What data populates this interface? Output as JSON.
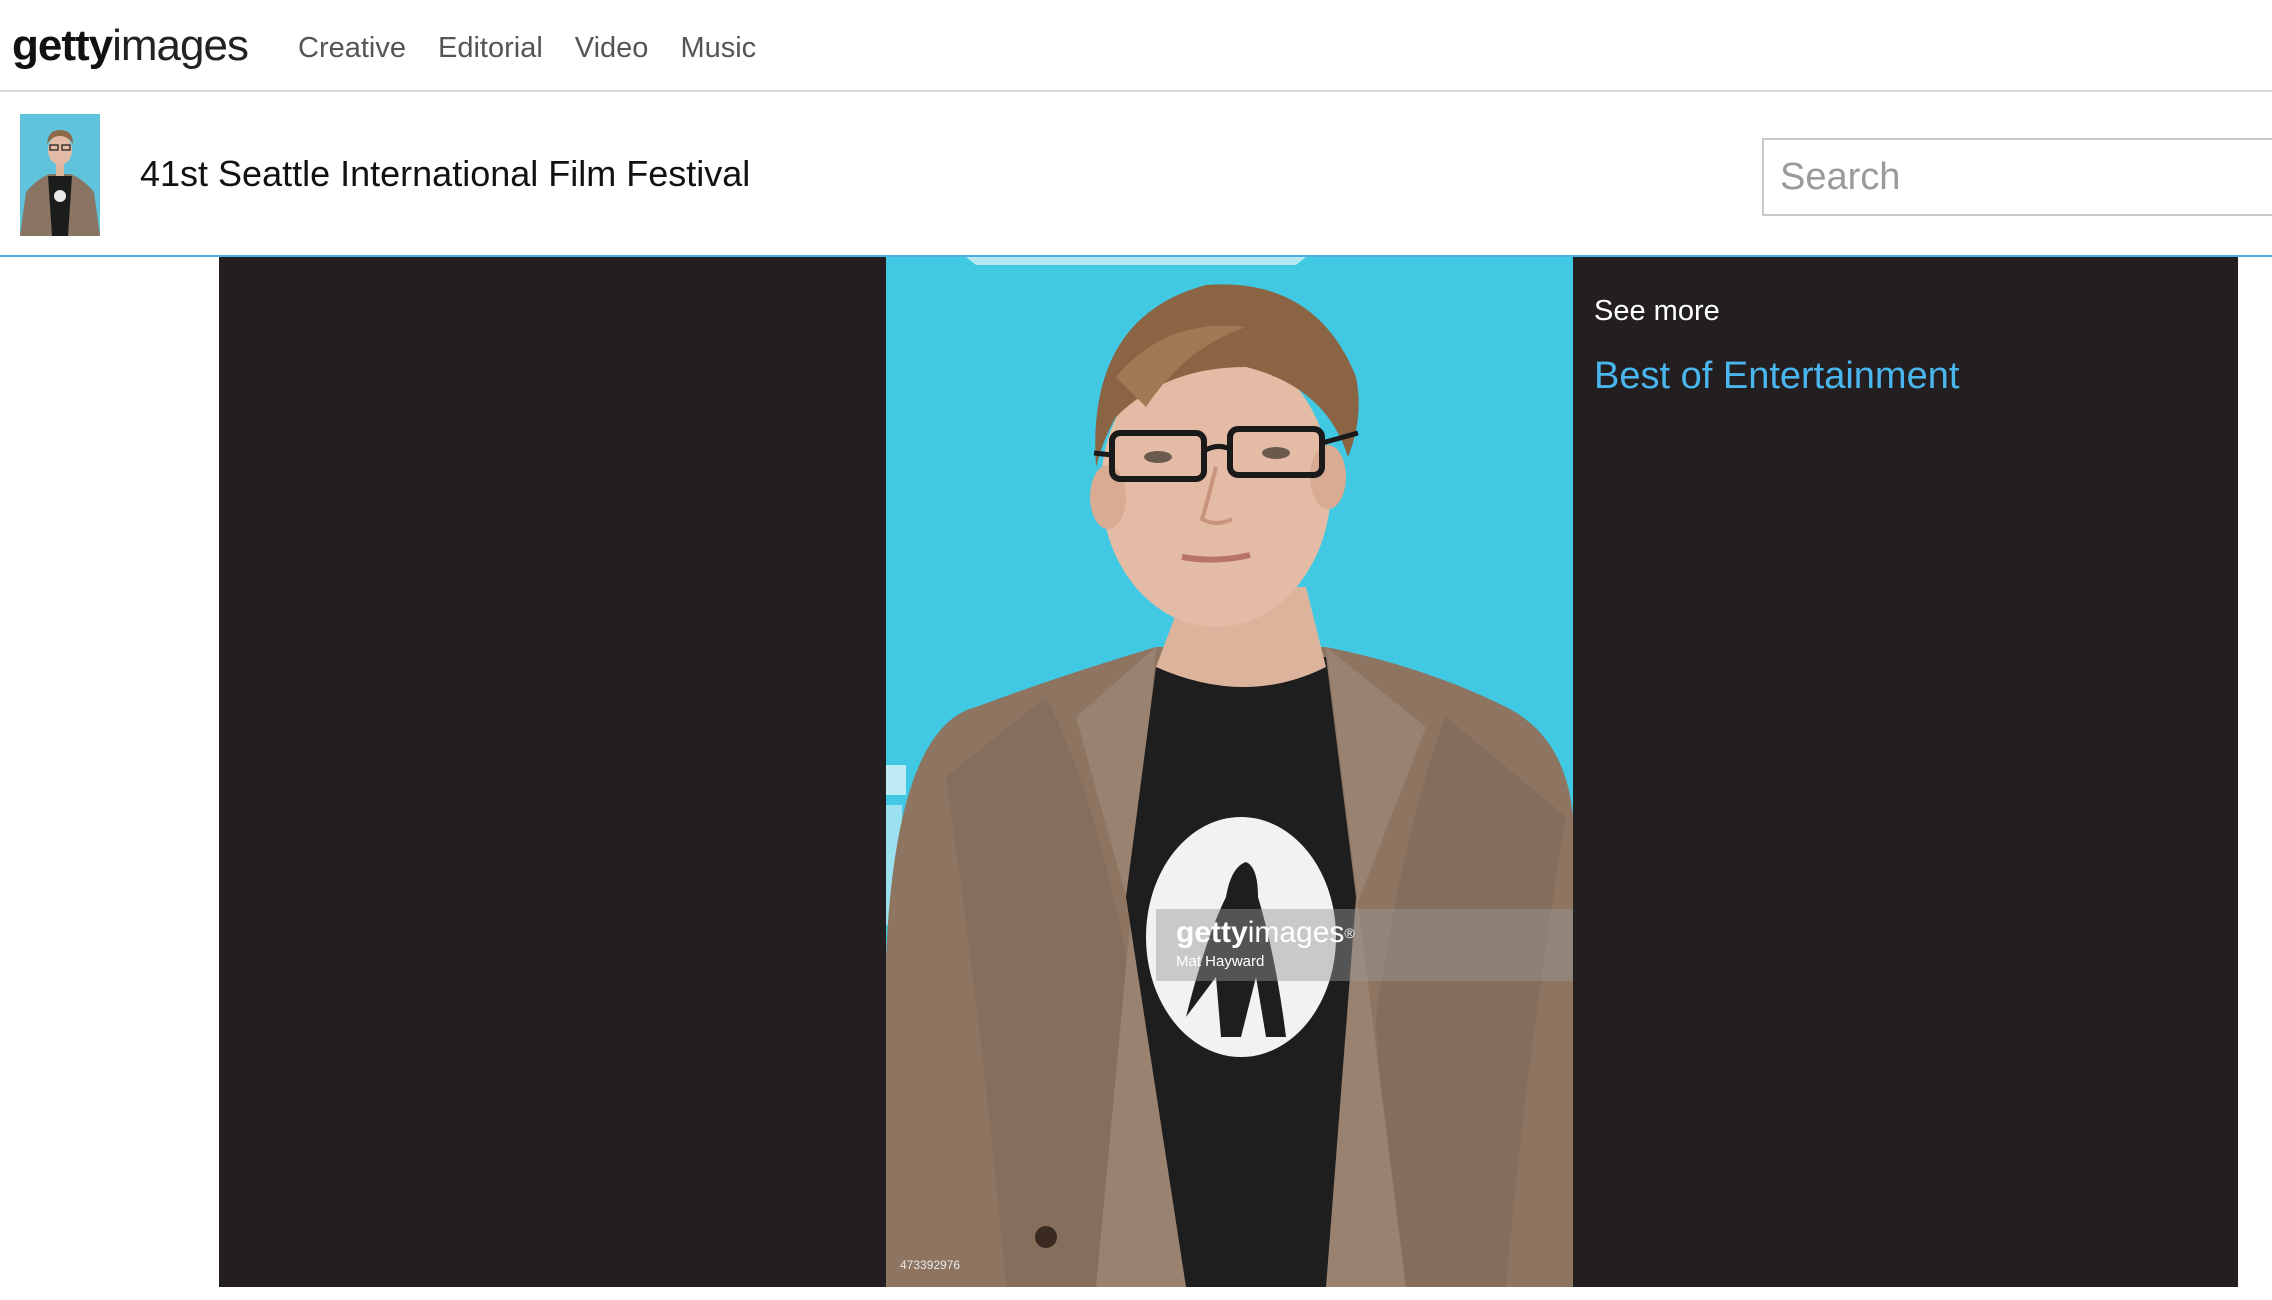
{
  "brand": {
    "logo_bold": "getty",
    "logo_light": "images"
  },
  "nav": {
    "links": [
      "Creative",
      "Editorial",
      "Video",
      "Music"
    ]
  },
  "event": {
    "title": "41st Seattle International Film Festival"
  },
  "search": {
    "placeholder": "Search"
  },
  "photo": {
    "watermark_bold": "getty",
    "watermark_light": "images",
    "watermark_reg": "®",
    "photographer": "Mat Hayward",
    "image_id": "473392976"
  },
  "sidebar": {
    "see_more_label": "See more",
    "link_label": "Best of Entertainment",
    "link_color": "#4ab6ee"
  },
  "colors": {
    "viewer_bg": "#231f20",
    "accent_line": "#4bb0e0",
    "backdrop": "#3ec6e0"
  }
}
